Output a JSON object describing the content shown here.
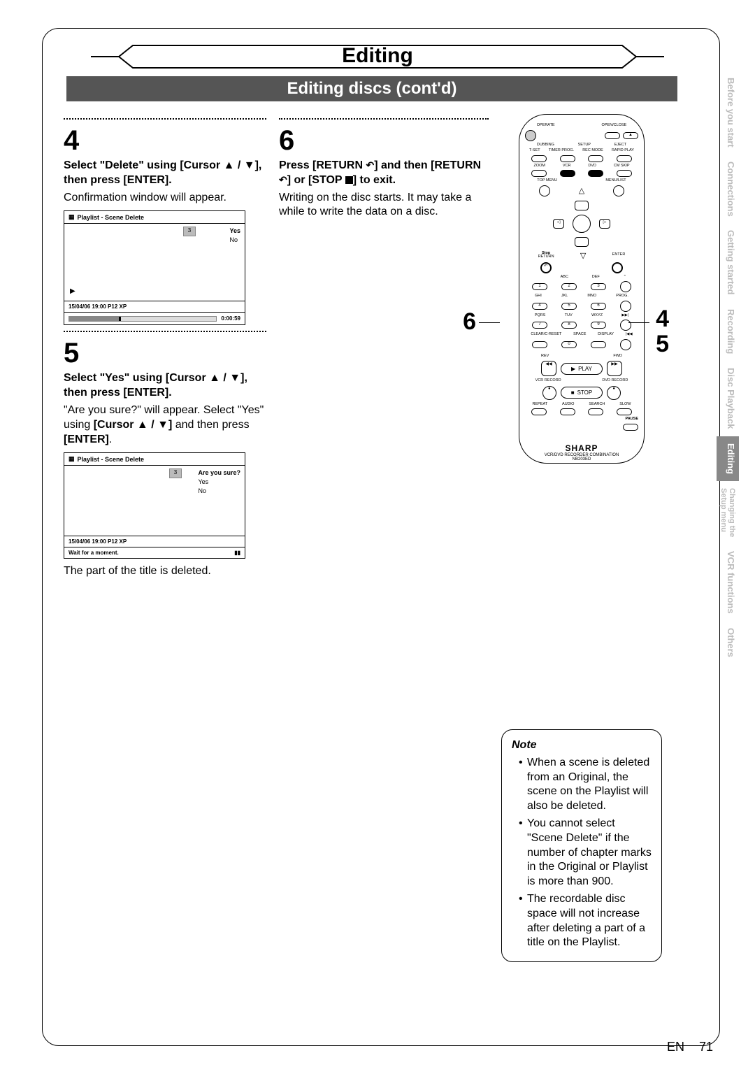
{
  "chapter": "Editing",
  "section": "Editing discs (cont'd)",
  "steps": {
    "s4": {
      "num": "4",
      "head": "Select \"Delete\" using [Cursor ▲ / ▼], then press [ENTER].",
      "body": "Confirmation window will appear."
    },
    "s5": {
      "num": "5",
      "head": "Select \"Yes\" using [Cursor ▲ / ▼], then press [ENTER].",
      "body1": "\"Are you sure?\" will appear. Select \"Yes\" using ",
      "body1b": "[Cursor ▲ / ▼]",
      "body1c": " and then press ",
      "body1d": "[ENTER]",
      "body1e": ".",
      "foot": "The part of the title is deleted."
    },
    "s6": {
      "num": "6",
      "head_a": "Press [RETURN ",
      "head_b": "] and then [RETURN ",
      "head_c": "] or [STOP ",
      "head_d": "] to exit.",
      "body": "Writing on the disc starts. It may take a while to write the data on a disc."
    }
  },
  "osd1": {
    "title": "Playlist - Scene Delete",
    "thumb": "3",
    "opt1": "Yes",
    "opt2": "No",
    "info": "15/04/06  19:00  P12  XP",
    "time": "0:00:59"
  },
  "osd2": {
    "title": "Playlist - Scene Delete",
    "thumb": "3",
    "q": "Are you sure?",
    "opt1": "Yes",
    "opt2": "No",
    "info": "15/04/06  19:00  P12  XP",
    "wait": "Wait for a moment."
  },
  "remote": {
    "r1": {
      "a": "OPERATE",
      "b": "",
      "c": "OPEN/CLOSE"
    },
    "r2": {
      "a": "DUBBING",
      "b": "SETUP",
      "c": "EJECT"
    },
    "r3": {
      "a": "T-SET",
      "b": "TIMER PROG.",
      "c": "REC MODE",
      "d": "RAPID PLAY"
    },
    "r4": {
      "a": "ZOOM",
      "b": "VCR",
      "c": "DVD",
      "d": "CM SKIP"
    },
    "r5": {
      "a": "TOP MENU",
      "b": "MENU/LIST"
    },
    "r6": {
      "a": "RETURN",
      "b": "ENTER"
    },
    "num": {
      "1": "1",
      "2": "2",
      "3": "3",
      "4": "4",
      "5": "5",
      "6": "6",
      "7": "7",
      "8": "8",
      "9": "9",
      "0": "0"
    },
    "numlbl": {
      "1": "",
      "2": "ABC",
      "3": "DEF",
      "4": "GHI",
      "5": "JKL",
      "6": "MNO",
      "7": "PQRS",
      "8": "TUV",
      "9": "WXYZ",
      "0": "SPACE"
    },
    "side1": "PROG.",
    "side2": "SKIP",
    "side3": "SKIP",
    "clear": "CLEAR/C-RESET",
    "disp": "DISPLAY",
    "rev": "REV",
    "fwd": "FWD",
    "play": "PLAY",
    "stop": "STOP",
    "vcrrec": "VCR RECORD",
    "dvdrec": "DVD RECORD",
    "bottom": {
      "a": "REPEAT",
      "b": "AUDIO",
      "c": "SEARCH",
      "d": "SLOW"
    },
    "pause": "PAUSE",
    "brand": "SHARP",
    "model": "VCR/DVD RECORDER COMBINATION",
    "model2": "NB203ED"
  },
  "callouts": {
    "c6": "6",
    "c4": "4",
    "c5": "5"
  },
  "note": {
    "title": "Note",
    "n1": "When a scene is deleted from an Original, the scene on the Playlist will also be deleted.",
    "n2": "You cannot select \"Scene Delete\" if the number of chapter marks in the Original or Playlist is more than 900.",
    "n3": "The recordable disc space will not increase after deleting a part of a title on the Playlist."
  },
  "tabs": {
    "t1": "Before you start",
    "t2": "Connections",
    "t3": "Getting started",
    "t4": "Recording",
    "t5": "Disc Playback",
    "t6": "Editing",
    "t7a": "Changing the",
    "t7b": "Setup menu",
    "t8": "VCR functions",
    "t9": "Others"
  },
  "footer": {
    "lang": "EN",
    "page": "71"
  }
}
